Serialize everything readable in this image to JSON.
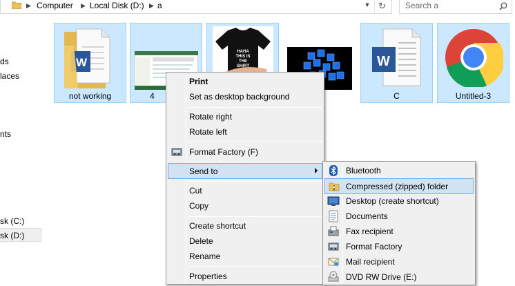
{
  "addressbar": {
    "crumbs": [
      "Computer",
      "Local Disk (D:)",
      "a"
    ],
    "search_placeholder": "Search a"
  },
  "nav": {
    "items": [
      "ds",
      "laces",
      "nts",
      "sk (C:)",
      "sk (D:)"
    ]
  },
  "thumbnails": [
    {
      "caption": "not working",
      "selected": true
    },
    {
      "caption": "4",
      "selected": true
    },
    {
      "caption": "",
      "selected": true,
      "shirt_text": "HAHA\nTHIS IS\nTHE\nSHIRT"
    },
    {
      "caption": "",
      "selected": false
    },
    {
      "caption": "C",
      "selected": true
    },
    {
      "caption": "Untitled-3",
      "selected": true
    }
  ],
  "context_menu": {
    "items": [
      {
        "label": "Print",
        "bold": true
      },
      {
        "label": "Set as desktop background"
      },
      {
        "label": "Rotate right"
      },
      {
        "label": "Rotate left"
      },
      {
        "label": "Format Factory (F)",
        "icon": "format-factory-icon"
      },
      {
        "label": "Send to",
        "submenu": true,
        "highlighted": true
      },
      {
        "label": "Cut"
      },
      {
        "label": "Copy"
      },
      {
        "label": "Create shortcut"
      },
      {
        "label": "Delete"
      },
      {
        "label": "Rename"
      },
      {
        "label": "Properties"
      }
    ]
  },
  "sendto_menu": {
    "items": [
      {
        "label": "Bluetooth",
        "icon": "bluetooth-icon"
      },
      {
        "label": "Compressed (zipped) folder",
        "icon": "zip-folder-icon",
        "highlighted": true
      },
      {
        "label": "Desktop (create shortcut)",
        "icon": "desktop-icon"
      },
      {
        "label": "Documents",
        "icon": "documents-icon"
      },
      {
        "label": "Fax recipient",
        "icon": "fax-icon"
      },
      {
        "label": "Format Factory",
        "icon": "format-factory-icon"
      },
      {
        "label": "Mail recipient",
        "icon": "mail-icon"
      },
      {
        "label": "DVD RW Drive (E:)",
        "icon": "dvd-drive-icon"
      }
    ]
  },
  "colors": {
    "selection_fill": "#cce8ff",
    "selection_border": "#99d1ff",
    "menu_bg": "#f0f0f0",
    "menu_highlight": "#d1e2f2"
  }
}
